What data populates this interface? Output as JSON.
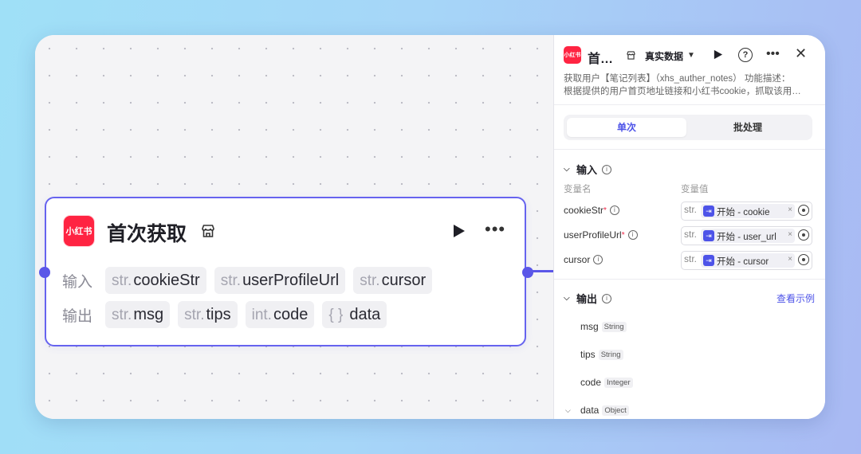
{
  "colors": {
    "accent": "#4d53e8",
    "node_border": "#6663ef",
    "brand_red": "#ff2442"
  },
  "node": {
    "logo_text": "小红书",
    "title": "首次获取",
    "icons": {
      "store": "store-icon",
      "play": "play-icon",
      "more": "more-icon"
    },
    "input_label": "输入",
    "output_label": "输出",
    "inputs": [
      {
        "type": "str.",
        "name": "cookieStr"
      },
      {
        "type": "str.",
        "name": "userProfileUrl"
      },
      {
        "type": "str.",
        "name": "cursor"
      }
    ],
    "outputs": [
      {
        "type": "str.",
        "name": "msg"
      },
      {
        "type": "str.",
        "name": "tips"
      },
      {
        "type": "int.",
        "name": "code"
      },
      {
        "type": "{ }",
        "name": "data"
      }
    ]
  },
  "panel": {
    "logo_text": "小红书",
    "title": "首…",
    "mode": "真实数据",
    "description": [
      "获取用户【笔记列表】（xhs_auther_notes） 功能描述：",
      "根据提供的用户首页地址链接和小红书cookie，抓取该用…"
    ],
    "tabs": [
      {
        "label": "单次",
        "active": true
      },
      {
        "label": "批处理",
        "active": false
      }
    ],
    "input_section": {
      "title": "输入",
      "col_name": "变量名",
      "col_value": "变量值",
      "rows": [
        {
          "name": "cookieStr",
          "required": "*",
          "type": "str.",
          "value": "开始 - cookie"
        },
        {
          "name": "userProfileUrl",
          "required": "*",
          "type": "str.",
          "value": "开始 - user_url"
        },
        {
          "name": "cursor",
          "required": "",
          "type": "str.",
          "value": "开始 - cursor"
        }
      ]
    },
    "output_section": {
      "title": "输出",
      "view_example": "查看示例",
      "items": [
        {
          "name": "msg",
          "type": "String"
        },
        {
          "name": "tips",
          "type": "String"
        },
        {
          "name": "code",
          "type": "Integer"
        },
        {
          "name": "data",
          "type": "Object"
        }
      ]
    }
  }
}
